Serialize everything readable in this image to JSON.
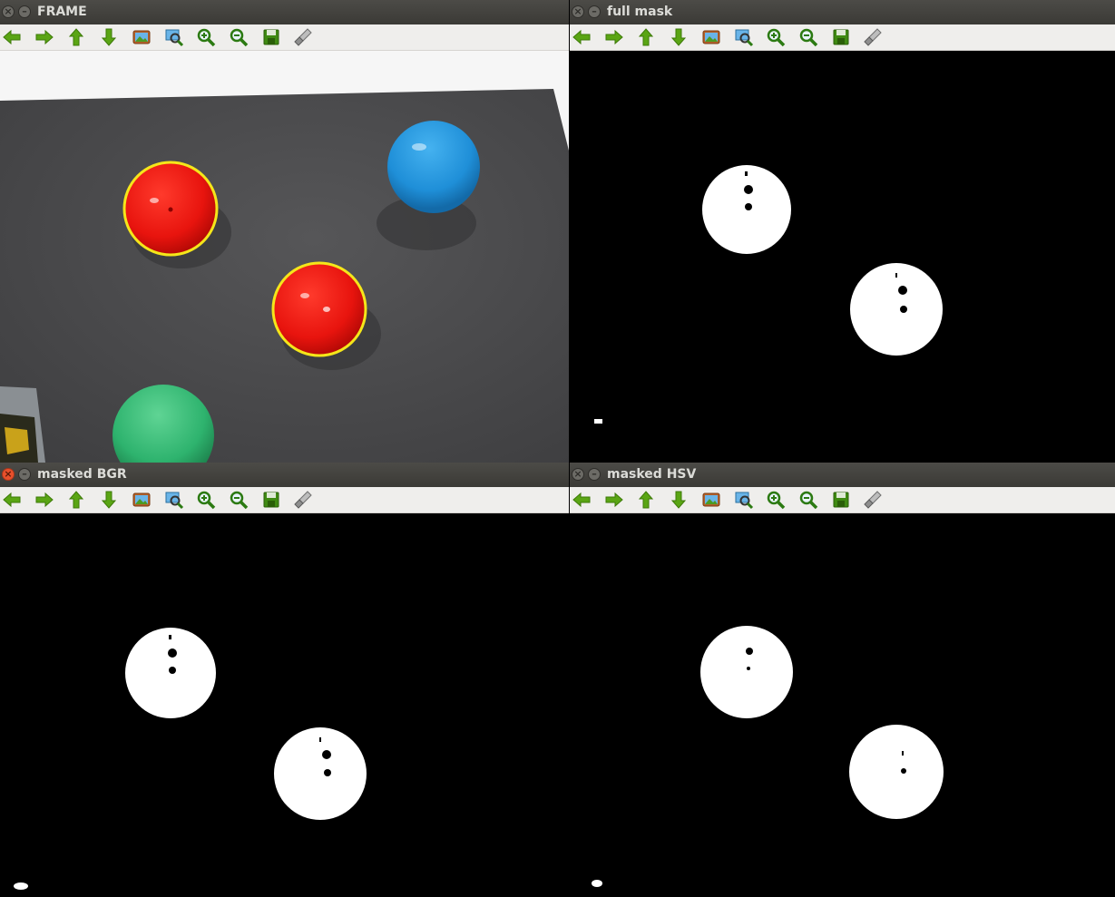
{
  "windows": [
    {
      "id": "frame",
      "title": "FRAME",
      "active": false
    },
    {
      "id": "full_mask",
      "title": "full mask",
      "active": false
    },
    {
      "id": "masked_bgr",
      "title": "masked BGR",
      "active": true
    },
    {
      "id": "masked_hsv",
      "title": "masked HSV",
      "active": false
    }
  ],
  "toolbar_icons": [
    "arrow-left-icon",
    "arrow-right-icon",
    "arrow-up-icon",
    "arrow-down-icon",
    "image-icon",
    "zoom-fit-icon",
    "zoom-in-icon",
    "zoom-out-icon",
    "save-icon",
    "properties-icon"
  ],
  "colors": {
    "ball_red": "#e8140e",
    "ball_blue": "#1f8fd8",
    "ball_green": "#2eb36e",
    "contour": "#f5e61a",
    "table": "#4b4b4d"
  }
}
